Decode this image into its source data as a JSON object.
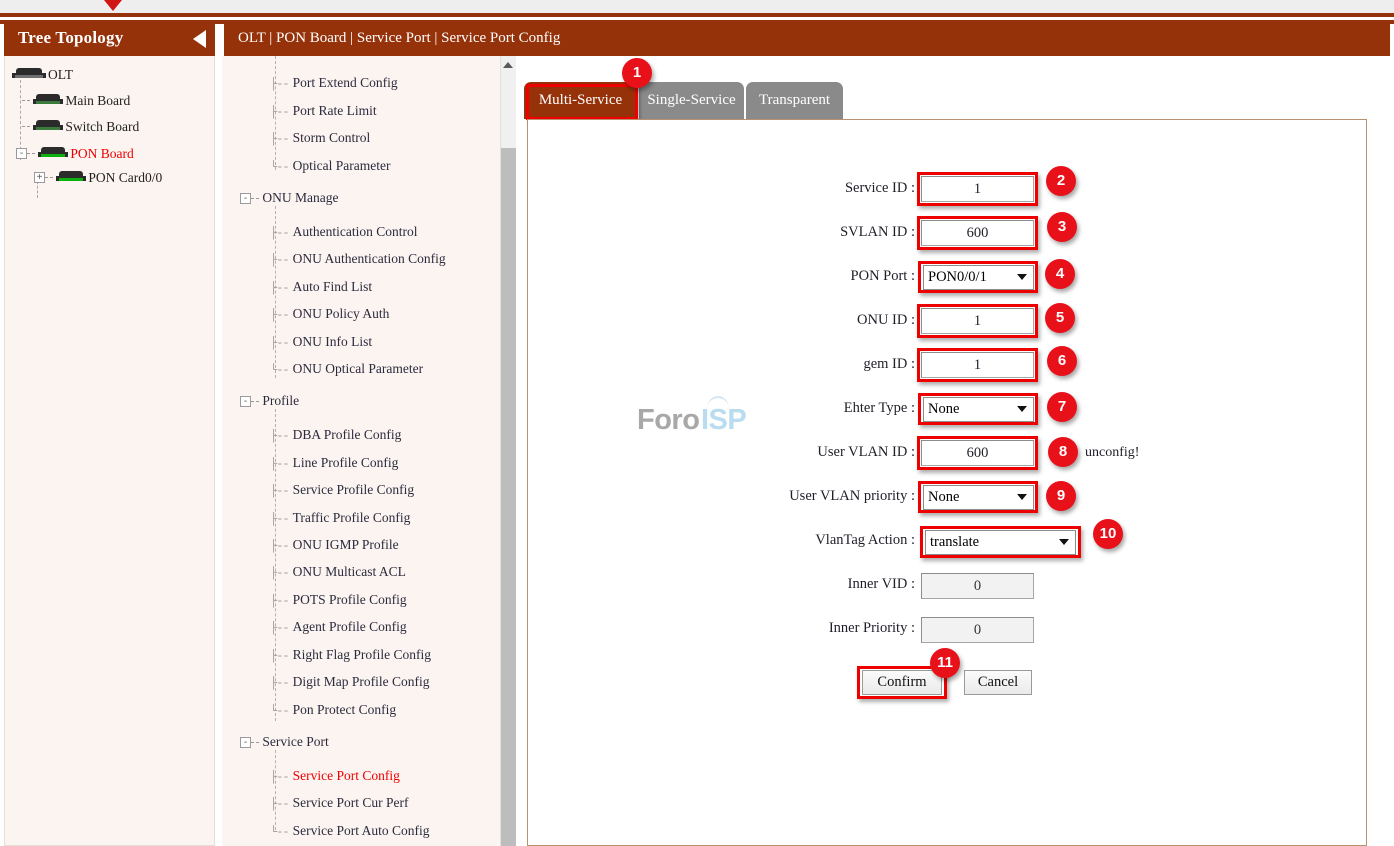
{
  "window": {
    "pointer_icon": "red-triangle-pointer"
  },
  "sidebar": {
    "title": "Tree Topology",
    "collapse_icon": "collapse-left-arrow-icon",
    "nodes": [
      {
        "label": "OLT",
        "icon": "device-icon",
        "expander": "",
        "highlight": false
      },
      {
        "label": "Main Board",
        "icon": "device-icon",
        "expander": "",
        "highlight": false
      },
      {
        "label": "Switch Board",
        "icon": "device-icon",
        "expander": "",
        "highlight": false
      },
      {
        "label": "PON Board",
        "icon": "device-icon",
        "expander": "-",
        "highlight": true
      },
      {
        "label": "PON Card0/0",
        "icon": "device-icon",
        "expander": "+",
        "highlight": false
      }
    ]
  },
  "menu": {
    "items": [
      {
        "label": "Port Extend Config",
        "type": "leaf",
        "red": false
      },
      {
        "label": "Port Rate Limit",
        "type": "leaf",
        "red": false
      },
      {
        "label": "Storm Control",
        "type": "leaf",
        "red": false
      },
      {
        "label": "Optical Parameter",
        "type": "leaf-last",
        "red": false
      },
      {
        "label": "ONU Manage",
        "type": "group",
        "red": false
      },
      {
        "label": "Authentication Control",
        "type": "leaf",
        "red": false
      },
      {
        "label": "ONU Authentication Config",
        "type": "leaf",
        "red": false
      },
      {
        "label": "Auto Find List",
        "type": "leaf",
        "red": false
      },
      {
        "label": "ONU Policy Auth",
        "type": "leaf",
        "red": false
      },
      {
        "label": "ONU Info List",
        "type": "leaf",
        "red": false
      },
      {
        "label": "ONU Optical Parameter",
        "type": "leaf-last",
        "red": false
      },
      {
        "label": "Profile",
        "type": "group",
        "red": false
      },
      {
        "label": "DBA Profile Config",
        "type": "leaf",
        "red": false
      },
      {
        "label": "Line Profile Config",
        "type": "leaf",
        "red": false
      },
      {
        "label": "Service Profile Config",
        "type": "leaf",
        "red": false
      },
      {
        "label": "Traffic Profile Config",
        "type": "leaf",
        "red": false
      },
      {
        "label": "ONU IGMP Profile",
        "type": "leaf",
        "red": false
      },
      {
        "label": "ONU Multicast ACL",
        "type": "leaf",
        "red": false
      },
      {
        "label": "POTS Profile Config",
        "type": "leaf",
        "red": false
      },
      {
        "label": "Agent Profile Config",
        "type": "leaf",
        "red": false
      },
      {
        "label": "Right Flag Profile Config",
        "type": "leaf",
        "red": false
      },
      {
        "label": "Digit Map Profile Config",
        "type": "leaf",
        "red": false
      },
      {
        "label": "Pon Protect Config",
        "type": "leaf-last",
        "red": false
      },
      {
        "label": "Service Port",
        "type": "group",
        "red": false
      },
      {
        "label": "Service Port Config",
        "type": "leaf",
        "red": true
      },
      {
        "label": "Service Port Cur Perf",
        "type": "leaf",
        "red": false
      },
      {
        "label": "Service Port Auto Config",
        "type": "leaf-last",
        "red": false
      }
    ],
    "scroll_up_icon": "scroll-up-arrow-icon"
  },
  "content": {
    "breadcrumb": "OLT | PON Board | Service Port | Service Port Config",
    "tabs": [
      {
        "label": "Multi-Service",
        "active": true
      },
      {
        "label": "Single-Service",
        "active": false
      },
      {
        "label": "Transparent",
        "active": false
      }
    ],
    "watermark": {
      "text_left": "Foro",
      "text_right": "ISP"
    },
    "form": {
      "fields": [
        {
          "label": "Service ID",
          "sep": ":",
          "value": "1",
          "kind": "text",
          "readonly": false
        },
        {
          "label": "SVLAN ID",
          "sep": ":",
          "value": "600",
          "kind": "text",
          "readonly": false
        },
        {
          "label": "PON Port",
          "sep": ":",
          "value": "PON0/0/1",
          "kind": "select",
          "readonly": false
        },
        {
          "label": "ONU ID",
          "sep": ":",
          "value": "1",
          "kind": "text",
          "readonly": false
        },
        {
          "label": "gem ID",
          "sep": ":",
          "value": "1",
          "kind": "text",
          "readonly": false
        },
        {
          "label": "Ehter Type",
          "sep": ":",
          "value": "None",
          "kind": "select",
          "readonly": false
        },
        {
          "label": "User VLAN ID",
          "sep": ":",
          "value": "600",
          "kind": "text",
          "readonly": false
        },
        {
          "label": "User VLAN priority",
          "sep": ":",
          "value": "None",
          "kind": "select",
          "readonly": false
        },
        {
          "label": "VlanTag Action",
          "sep": ":",
          "value": "translate",
          "kind": "select",
          "readonly": false
        },
        {
          "label": "Inner VID",
          "sep": ":",
          "value": "0",
          "kind": "text",
          "readonly": true
        },
        {
          "label": "Inner Priority",
          "sep": ":",
          "value": "0",
          "kind": "text",
          "readonly": true
        }
      ],
      "hint": "unconfig!",
      "confirm_label": "Confirm",
      "cancel_label": "Cancel"
    }
  },
  "annotations": {
    "accent_color": "#ee0000",
    "badge_color": "#e8111a",
    "steps": [
      "1",
      "2",
      "3",
      "4",
      "5",
      "6",
      "7",
      "8",
      "9",
      "10",
      "11"
    ]
  },
  "theme": {
    "header_brown": "#96320a",
    "panel_cream": "#fbf4f0",
    "tab_inactive_grey": "#8a8a8a",
    "link_red": "#ee0000"
  }
}
